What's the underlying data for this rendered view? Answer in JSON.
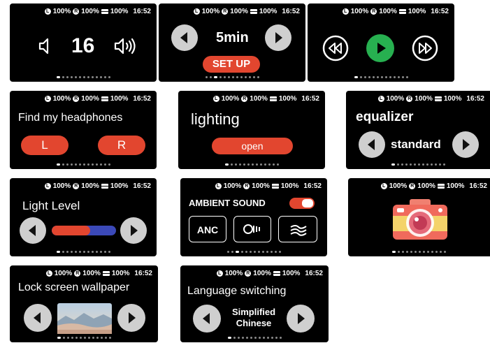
{
  "status": {
    "left": "100%",
    "right": "100%",
    "battery": "100%",
    "time": "16:52",
    "left_letter": "L",
    "right_letter": "R"
  },
  "volume": {
    "value": "16"
  },
  "timer": {
    "value": "5min",
    "button": "SET UP"
  },
  "find": {
    "title": "Find my headphones",
    "left": "L",
    "right": "R"
  },
  "lighting": {
    "title": "lighting",
    "button": "open"
  },
  "equalizer": {
    "title": "equalizer",
    "value": "standard"
  },
  "light_level": {
    "title": "Light Level",
    "fill_fraction": 0.6
  },
  "ambient": {
    "title": "AMBIENT SOUND",
    "mode1": "ANC",
    "toggle_on": true
  },
  "wallpaper": {
    "title": "Lock screen wallpaper"
  },
  "language": {
    "title": "Language switching",
    "line1": "Simplified",
    "line2": "Chinese"
  },
  "colors": {
    "accent": "#e2462f",
    "play": "#27b050",
    "level_blue": "#3b49b8",
    "button_gray": "#cfcfcf"
  },
  "icons": [
    "volume-down-icon",
    "volume-up-icon",
    "rewind-icon",
    "play-icon",
    "fast-forward-icon",
    "arrow-left-icon",
    "arrow-right-icon",
    "transparency-icon",
    "wind-noise-icon",
    "camera-icon"
  ]
}
